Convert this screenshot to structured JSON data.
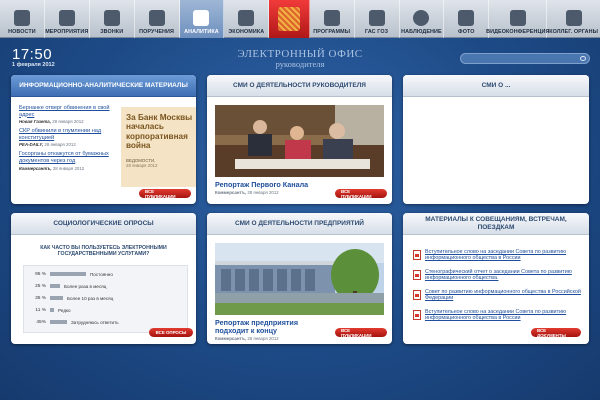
{
  "nav": [
    {
      "label": "Новости",
      "icon": "phone-device-icon",
      "active": false
    },
    {
      "label": "Мероприятия",
      "icon": "pen-icon",
      "active": false
    },
    {
      "label": "Звонки",
      "icon": "phone-handset-icon",
      "active": false
    },
    {
      "label": "Поручения",
      "icon": "people-icon",
      "active": false
    },
    {
      "label": "Аналитика",
      "icon": "analytics-icon",
      "active": true
    },
    {
      "label": "Экономика",
      "icon": "coins-icon",
      "active": false
    },
    {
      "label": "",
      "icon": "emblem-icon",
      "active": false
    },
    {
      "label": "Программы",
      "icon": "briefcase-icon",
      "active": false
    },
    {
      "label": "ГАС ГОЗ",
      "icon": "monitor-icon",
      "active": false
    },
    {
      "label": "Наблюдение",
      "icon": "camera-icon",
      "active": false
    },
    {
      "label": "Фото",
      "icon": "photo-camera-icon",
      "active": false
    },
    {
      "label": "Видеоконференция",
      "icon": "video-conference-icon",
      "active": false
    },
    {
      "label": "Коллег. органы",
      "icon": "building-icon",
      "active": false
    }
  ],
  "header": {
    "time": "17:50",
    "date": "1 февраля 2012",
    "title": "ЭЛЕКТРОННЫЙ ОФИС",
    "subtitle": "руководителя",
    "search_placeholder": ""
  },
  "panels": {
    "analytics": {
      "title": "Информационно-аналитические материалы",
      "news": [
        {
          "link": "Бернанке отверг обвинения в свой адрес",
          "source": "Новая Газета,",
          "date": "28 января 2012"
        },
        {
          "link": "СКР обвинили в глумлении над конституцией",
          "source": "PEA-DAILY,",
          "date": "28 января 2012"
        },
        {
          "link": "Госорганы откажутся от бумажных документов через год",
          "source": "Коммерсантъ,",
          "date": "28 января 2012"
        }
      ],
      "feature": {
        "text": "За Банк Москвы началась корпоративная война",
        "source": "Ведомости,",
        "date": "28 января 2012"
      },
      "button": "Все публикации"
    },
    "media_head": {
      "title": "СМИ о деятельности руководителя",
      "caption": "Репортаж Первого Канала",
      "source": "Коммерсантъ,",
      "date": "28 января 2012",
      "button": "Все публикации"
    },
    "media_other": {
      "title": "СМИ о ..."
    },
    "poll": {
      "title": "Социологические опросы",
      "question": "Как часто вы пользуетесь электронными государственными услугами?",
      "rows": [
        {
          "pct": "95 %",
          "value": 0.95,
          "label": "Постоянно"
        },
        {
          "pct": "25 %",
          "value": 0.25,
          "label": "Более раза в месяц"
        },
        {
          "pct": "35 %",
          "value": 0.35,
          "label": "Более 10 раз в месяц"
        },
        {
          "pct": "11 %",
          "value": 0.11,
          "label": "Редко"
        },
        {
          "pct": "45%",
          "value": 0.45,
          "label": "Затрудняюсь ответить"
        }
      ],
      "button": "Все опросы"
    },
    "media_company": {
      "title": "СМИ о деятельности предприятий",
      "caption": "Репортаж предприятия подходит к концу",
      "source": "Коммерсантъ,",
      "date": "28 января 2012",
      "button": "Все публикации"
    },
    "meetings": {
      "title": "Материалы к совещаниям, встречам, поездкам",
      "docs": [
        "Вступительное слово на заседании Совета по развитию информационного общества в России",
        "Стенографический отчет о заседании Совета по развитию информационного общества.",
        "Совет по развитию информационного общества в Российской Федерации",
        "Вступительное слово на заседании Совета по развитию информационного общества в России"
      ],
      "button": "Все документы"
    }
  },
  "colors": {
    "accent_red": "#c0201a",
    "link_blue": "#1f4f9c",
    "bg_blue": "#1d4a86"
  }
}
